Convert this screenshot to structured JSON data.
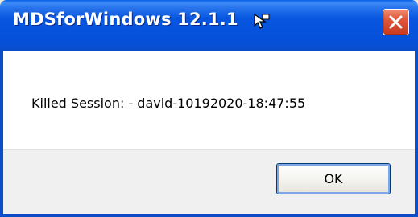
{
  "window": {
    "title": "MDSforWindows 12.1.1"
  },
  "dialog": {
    "message": "Killed Session: - david-10192020-18:47:55",
    "ok_label": "OK"
  },
  "icons": {
    "close": "close-icon",
    "cursor": "cursor-icon"
  },
  "colors": {
    "titlebar": "#0857e0",
    "close_button": "#e0563a",
    "button_area": "#f0f0f0"
  }
}
